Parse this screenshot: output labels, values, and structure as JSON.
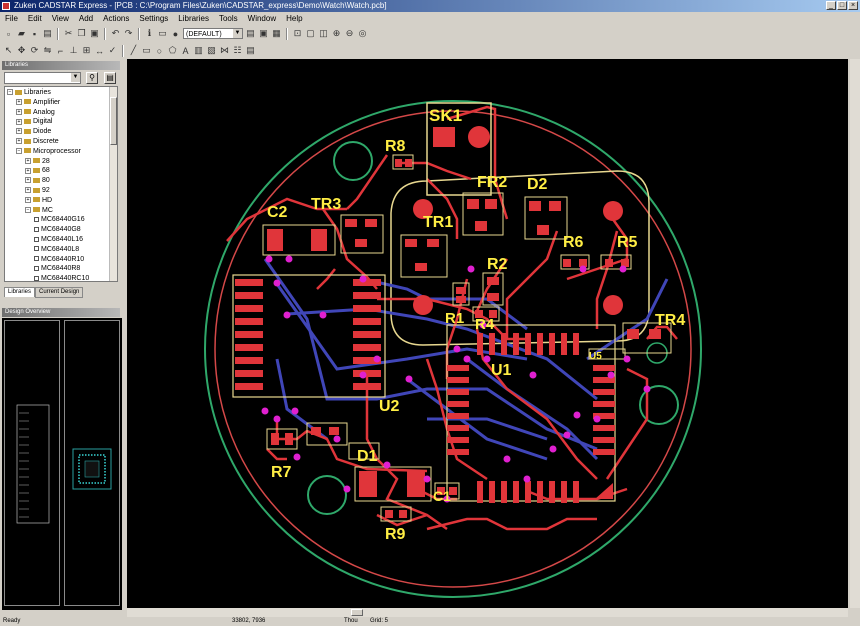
{
  "window": {
    "title": "Zuken CADSTAR Express - [PCB : C:\\Program Files\\Zuken\\CADSTAR_express\\Demo\\Watch\\Watch.pcb]"
  },
  "menu": [
    "File",
    "Edit",
    "View",
    "Add",
    "Actions",
    "Settings",
    "Libraries",
    "Tools",
    "Window",
    "Help"
  ],
  "toolbar": {
    "layer_combo": "(DEFAULT)"
  },
  "library_panel": {
    "header": "Libraries",
    "tree": [
      {
        "label": "Libraries",
        "level": 0,
        "kind": "root"
      },
      {
        "label": "Amplifier",
        "level": 1,
        "kind": "folder"
      },
      {
        "label": "Analog",
        "level": 1,
        "kind": "folder"
      },
      {
        "label": "Digital",
        "level": 1,
        "kind": "folder"
      },
      {
        "label": "Diode",
        "level": 1,
        "kind": "folder"
      },
      {
        "label": "Discrete",
        "level": 1,
        "kind": "folder"
      },
      {
        "label": "Microprocessor",
        "level": 1,
        "kind": "folder"
      },
      {
        "label": "28",
        "level": 2,
        "kind": "folder"
      },
      {
        "label": "68",
        "level": 2,
        "kind": "folder"
      },
      {
        "label": "80",
        "level": 2,
        "kind": "folder"
      },
      {
        "label": "92",
        "level": 2,
        "kind": "folder"
      },
      {
        "label": "HD",
        "level": 2,
        "kind": "folder"
      },
      {
        "label": "MC",
        "level": 2,
        "kind": "folder"
      },
      {
        "label": "MC68440G16",
        "level": 3,
        "kind": "comp"
      },
      {
        "label": "MC68440G8",
        "level": 3,
        "kind": "comp"
      },
      {
        "label": "MC68440L16",
        "level": 3,
        "kind": "comp"
      },
      {
        "label": "MC68440L8",
        "level": 3,
        "kind": "comp"
      },
      {
        "label": "MC68440R10",
        "level": 3,
        "kind": "comp"
      },
      {
        "label": "MC68440R8",
        "level": 3,
        "kind": "comp"
      },
      {
        "label": "MC68440RC10",
        "level": 3,
        "kind": "comp"
      }
    ],
    "tabs": [
      "Libraries",
      "Current Design"
    ]
  },
  "overview_panel": {
    "header": "Design Overview"
  },
  "pcb": {
    "labels": [
      "SK1",
      "R8",
      "FR2",
      "D2",
      "C2",
      "TR3",
      "TR1",
      "R6",
      "R5",
      "R2",
      "R1",
      "R4",
      "TR4",
      "U1",
      "U2",
      "R7",
      "D1",
      "C1",
      "R9",
      "U5"
    ],
    "colors": {
      "background": "#000000",
      "board_outline": "#2fa86a",
      "top_copper": "#e0353a",
      "bottom_copper": "#4046b8",
      "silkscreen": "#e8d890",
      "label": "#ffee44",
      "via": "#e020d0"
    }
  },
  "status": {
    "left": "Ready",
    "coords": "33802, 7936",
    "units": "Thou",
    "grid": "Grid: 5"
  }
}
